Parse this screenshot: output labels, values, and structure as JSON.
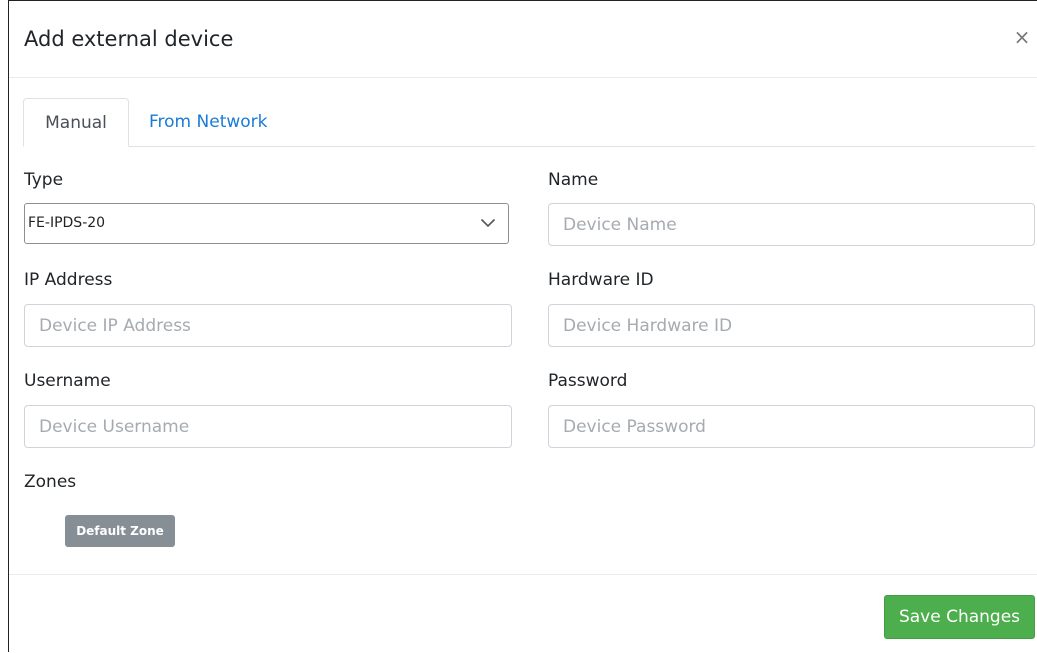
{
  "modal": {
    "title": "Add external device",
    "close_glyph": "×"
  },
  "tabs": [
    {
      "label": "Manual",
      "active": true
    },
    {
      "label": "From Network",
      "active": false
    }
  ],
  "form": {
    "type": {
      "label": "Type",
      "value": "FE-IPDS-20",
      "icon": "chevron-down-icon"
    },
    "name": {
      "label": "Name",
      "placeholder": "Device Name",
      "value": ""
    },
    "ip_address": {
      "label": "IP Address",
      "placeholder": "Device IP Address",
      "value": ""
    },
    "hardware_id": {
      "label": "Hardware ID",
      "placeholder": "Device Hardware ID",
      "value": ""
    },
    "username": {
      "label": "Username",
      "placeholder": "Device Username",
      "value": ""
    },
    "password": {
      "label": "Password",
      "placeholder": "Device Password",
      "value": ""
    },
    "zones": {
      "label": "Zones",
      "items": [
        "Default Zone"
      ]
    }
  },
  "footer": {
    "save_label": "Save Changes"
  },
  "colors": {
    "link": "#1a7bd6",
    "save_button": "#4cae4c",
    "badge": "#868e96"
  }
}
